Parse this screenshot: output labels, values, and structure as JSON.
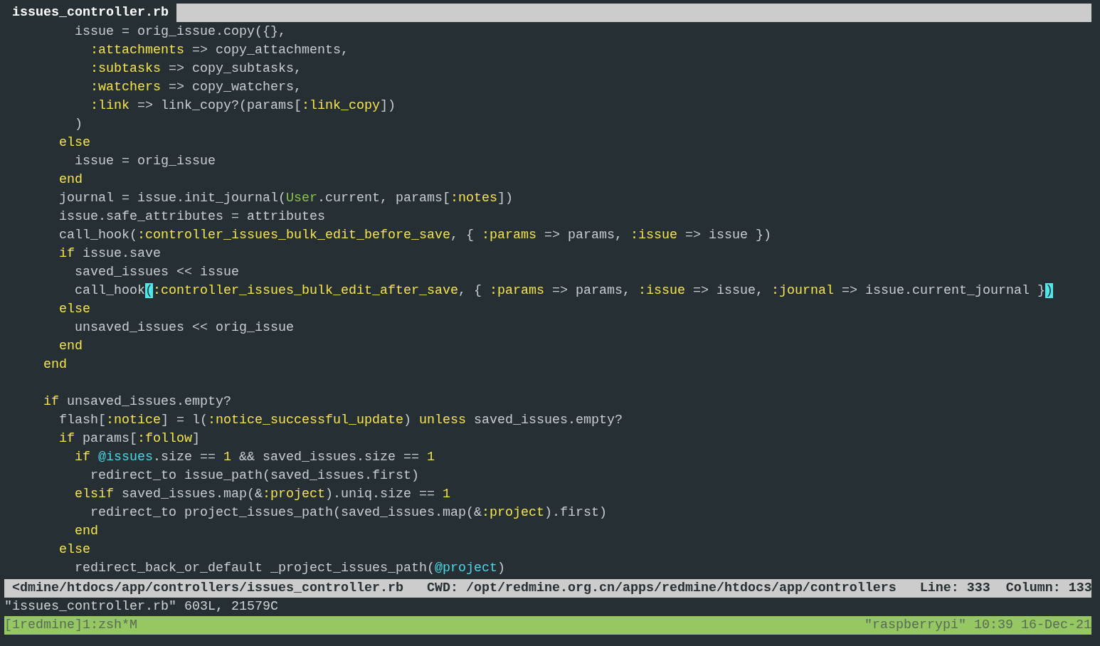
{
  "tab_line": {
    "active_tab": {
      "label": "issues_controller.rb",
      "selected": true
    }
  },
  "code_lines": [
    {
      "tokens": [
        {
          "text": "         issue = orig_issue.copy({},",
          "kind": "plain"
        }
      ]
    },
    {
      "tokens": [
        {
          "text": "           :attachments",
          "kind": "symbol"
        },
        {
          "text": " => copy_attachments,",
          "kind": "plain"
        }
      ]
    },
    {
      "tokens": [
        {
          "text": "           :subtasks",
          "kind": "symbol"
        },
        {
          "text": " => copy_subtasks,",
          "kind": "plain"
        }
      ]
    },
    {
      "tokens": [
        {
          "text": "           :watchers",
          "kind": "symbol"
        },
        {
          "text": " => copy_watchers,",
          "kind": "plain"
        }
      ]
    },
    {
      "tokens": [
        {
          "text": "           :link",
          "kind": "symbol"
        },
        {
          "text": " => link_copy?(params[",
          "kind": "plain"
        },
        {
          "text": ":link_copy",
          "kind": "symbol"
        },
        {
          "text": "])",
          "kind": "plain"
        }
      ]
    },
    {
      "tokens": [
        {
          "text": "         )",
          "kind": "plain"
        }
      ]
    },
    {
      "tokens": [
        {
          "text": "       else",
          "kind": "keyword"
        }
      ]
    },
    {
      "tokens": [
        {
          "text": "         issue = orig_issue",
          "kind": "plain"
        }
      ]
    },
    {
      "tokens": [
        {
          "text": "       end",
          "kind": "keyword"
        }
      ]
    },
    {
      "tokens": [
        {
          "text": "       journal = issue.init_journal(",
          "kind": "plain"
        },
        {
          "text": "User",
          "kind": "constant"
        },
        {
          "text": ".current, params[",
          "kind": "plain"
        },
        {
          "text": ":notes",
          "kind": "symbol"
        },
        {
          "text": "])",
          "kind": "plain"
        }
      ]
    },
    {
      "tokens": [
        {
          "text": "       issue.safe_attributes = attributes",
          "kind": "plain"
        }
      ]
    },
    {
      "tokens": [
        {
          "text": "       call_hook(",
          "kind": "plain"
        },
        {
          "text": ":controller_issues_bulk_edit_before_save",
          "kind": "symbol"
        },
        {
          "text": ", { ",
          "kind": "plain"
        },
        {
          "text": ":params",
          "kind": "symbol"
        },
        {
          "text": " => params, ",
          "kind": "plain"
        },
        {
          "text": ":issue",
          "kind": "symbol"
        },
        {
          "text": " => issue })",
          "kind": "plain"
        }
      ]
    },
    {
      "tokens": [
        {
          "text": "       if",
          "kind": "keyword"
        },
        {
          "text": " issue.save",
          "kind": "plain"
        }
      ]
    },
    {
      "tokens": [
        {
          "text": "         saved_issues << issue",
          "kind": "plain"
        }
      ]
    },
    {
      "tokens": [
        {
          "text": "         call_hook",
          "kind": "plain"
        },
        {
          "text": "(",
          "kind": "match"
        },
        {
          "text": ":controller_issues_bulk_edit_after_save",
          "kind": "symbol"
        },
        {
          "text": ", { ",
          "kind": "plain"
        },
        {
          "text": ":params",
          "kind": "symbol"
        },
        {
          "text": " => params, ",
          "kind": "plain"
        },
        {
          "text": ":issue",
          "kind": "symbol"
        },
        {
          "text": " => issue, ",
          "kind": "plain"
        },
        {
          "text": ":journal",
          "kind": "symbol"
        },
        {
          "text": " => issue.current_journal }",
          "kind": "plain"
        },
        {
          "text": ")",
          "kind": "match"
        }
      ]
    },
    {
      "tokens": [
        {
          "text": "       else",
          "kind": "keyword"
        }
      ]
    },
    {
      "tokens": [
        {
          "text": "         unsaved_issues << orig_issue",
          "kind": "plain"
        }
      ]
    },
    {
      "tokens": [
        {
          "text": "       end",
          "kind": "keyword"
        }
      ]
    },
    {
      "tokens": [
        {
          "text": "     end",
          "kind": "keyword"
        }
      ]
    },
    {
      "kind": "blank"
    },
    {
      "tokens": [
        {
          "text": "     if",
          "kind": "keyword"
        },
        {
          "text": " unsaved_issues.empty?",
          "kind": "plain"
        }
      ]
    },
    {
      "tokens": [
        {
          "text": "       flash[",
          "kind": "plain"
        },
        {
          "text": ":notice",
          "kind": "symbol"
        },
        {
          "text": "] = l(",
          "kind": "plain"
        },
        {
          "text": ":notice_successful_update",
          "kind": "symbol"
        },
        {
          "text": ") ",
          "kind": "plain"
        },
        {
          "text": "unless",
          "kind": "keyword"
        },
        {
          "text": " saved_issues.empty?",
          "kind": "plain"
        }
      ]
    },
    {
      "tokens": [
        {
          "text": "       if",
          "kind": "keyword"
        },
        {
          "text": " params[",
          "kind": "plain"
        },
        {
          "text": ":follow",
          "kind": "symbol"
        },
        {
          "text": "]",
          "kind": "plain"
        }
      ]
    },
    {
      "tokens": [
        {
          "text": "         if",
          "kind": "keyword"
        },
        {
          "text": " @issues",
          "kind": "ivar"
        },
        {
          "text": ".size == ",
          "kind": "plain"
        },
        {
          "text": "1",
          "kind": "keyword"
        },
        {
          "text": " && saved_issues.size == ",
          "kind": "plain"
        },
        {
          "text": "1",
          "kind": "keyword"
        }
      ]
    },
    {
      "tokens": [
        {
          "text": "           redirect_to issue_path(saved_issues.first)",
          "kind": "plain"
        }
      ]
    },
    {
      "tokens": [
        {
          "text": "         elsif",
          "kind": "keyword"
        },
        {
          "text": " saved_issues.map(&",
          "kind": "plain"
        },
        {
          "text": ":project",
          "kind": "symbol"
        },
        {
          "text": ").uniq.size == ",
          "kind": "plain"
        },
        {
          "text": "1",
          "kind": "keyword"
        }
      ]
    },
    {
      "tokens": [
        {
          "text": "           redirect_to project_issues_path(saved_issues.map(&",
          "kind": "plain"
        },
        {
          "text": ":project",
          "kind": "symbol"
        },
        {
          "text": ").first)",
          "kind": "plain"
        }
      ]
    },
    {
      "tokens": [
        {
          "text": "         end",
          "kind": "keyword"
        }
      ]
    },
    {
      "tokens": [
        {
          "text": "       else",
          "kind": "keyword"
        }
      ]
    },
    {
      "tokens": [
        {
          "text": "         redirect_back_or_default _project_issues_path(",
          "kind": "plain"
        },
        {
          "text": "@project",
          "kind": "ivar"
        },
        {
          "text": ")",
          "kind": "plain"
        }
      ]
    }
  ],
  "status_line": {
    "file_path": "<dmine/htdocs/app/controllers/issues_controller.rb",
    "cwd": "CWD: /opt/redmine.org.cn/apps/redmine/htdocs/app/controllers",
    "line": "Line: 333",
    "column": "Column: 133"
  },
  "message_line": "\"issues_controller.rb\" 603L, 21579C",
  "tmux_bar": {
    "windows": "[1redmine]1:zsh*M",
    "host_time": "\"raspberrypi\" 10:39 16-Dec-21"
  }
}
